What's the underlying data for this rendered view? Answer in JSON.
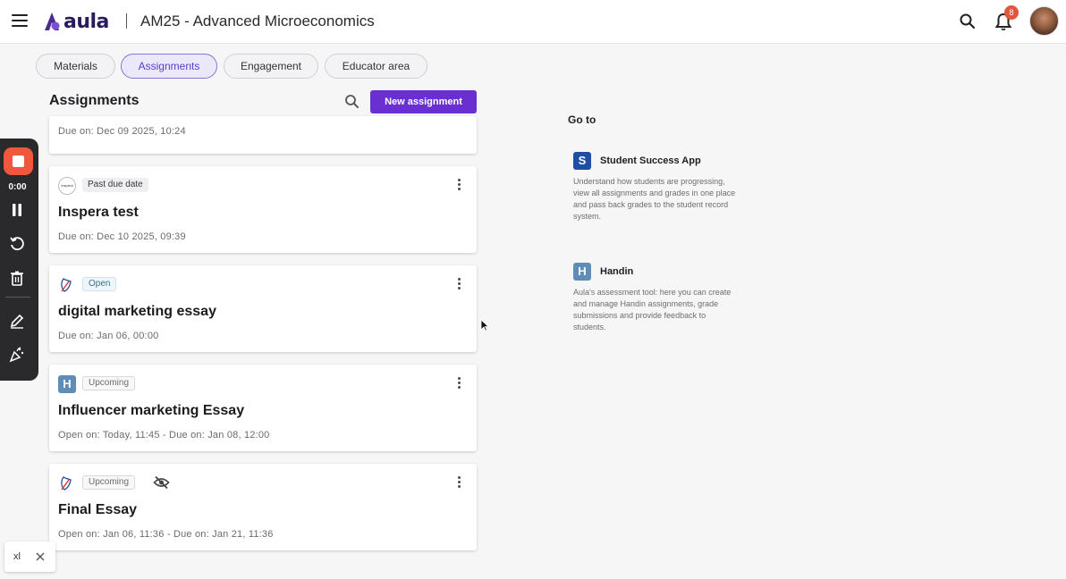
{
  "header": {
    "logo_text": "aula",
    "course_title": "AM25 - Advanced Microeconomics",
    "notification_count": "8",
    "brand_color": "#2b1a5e"
  },
  "tabs": [
    {
      "label": "Materials",
      "active": false
    },
    {
      "label": "Assignments",
      "active": true
    },
    {
      "label": "Engagement",
      "active": false
    },
    {
      "label": "Educator area",
      "active": false
    }
  ],
  "assignments": {
    "title": "Assignments",
    "new_button": "New assignment",
    "accent_color": "#6a2fd1",
    "cards": [
      {
        "title": "",
        "status": "",
        "date": "Due on: Dec 09 2025, 10:24",
        "source_icon": ""
      },
      {
        "title": "Inspera test",
        "status": "Past due date",
        "date": "Due on: Dec 10 2025, 09:39",
        "source_icon": "inspera-icon",
        "source_label": "inspera"
      },
      {
        "title": "digital marketing essay",
        "status": "Open",
        "date": "Due on: Jan 06, 00:00",
        "source_icon": "feather-icon"
      },
      {
        "title": "Influencer marketing Essay",
        "status": "Upcoming",
        "date": "Open on: Today, 11:45 - Due on: Jan 08, 12:00",
        "source_icon": "handin-icon",
        "source_label": "H"
      },
      {
        "title": "Final Essay",
        "status": "Upcoming",
        "date": "Open on: Jan 06, 11:36 - Due on: Jan 21, 11:36",
        "source_icon": "feather-icon",
        "hidden": true
      }
    ]
  },
  "goto": {
    "title": "Go to",
    "apps": [
      {
        "icon_letter": "S",
        "name": "Student Success App",
        "description": "Understand how students are progressing, view all assignments and grades in one place and pass back grades to the student record system.",
        "color": "#1f4fa3"
      },
      {
        "icon_letter": "H",
        "name": "Handin",
        "description": "Aula's assessment tool: here you can create and manage Handin assignments, grade submissions and provide feedback to students.",
        "color": "#5f8db5"
      }
    ]
  },
  "recorder": {
    "time": "0:00",
    "stop_color": "#f0583d"
  },
  "chip": {
    "text": "xl"
  }
}
